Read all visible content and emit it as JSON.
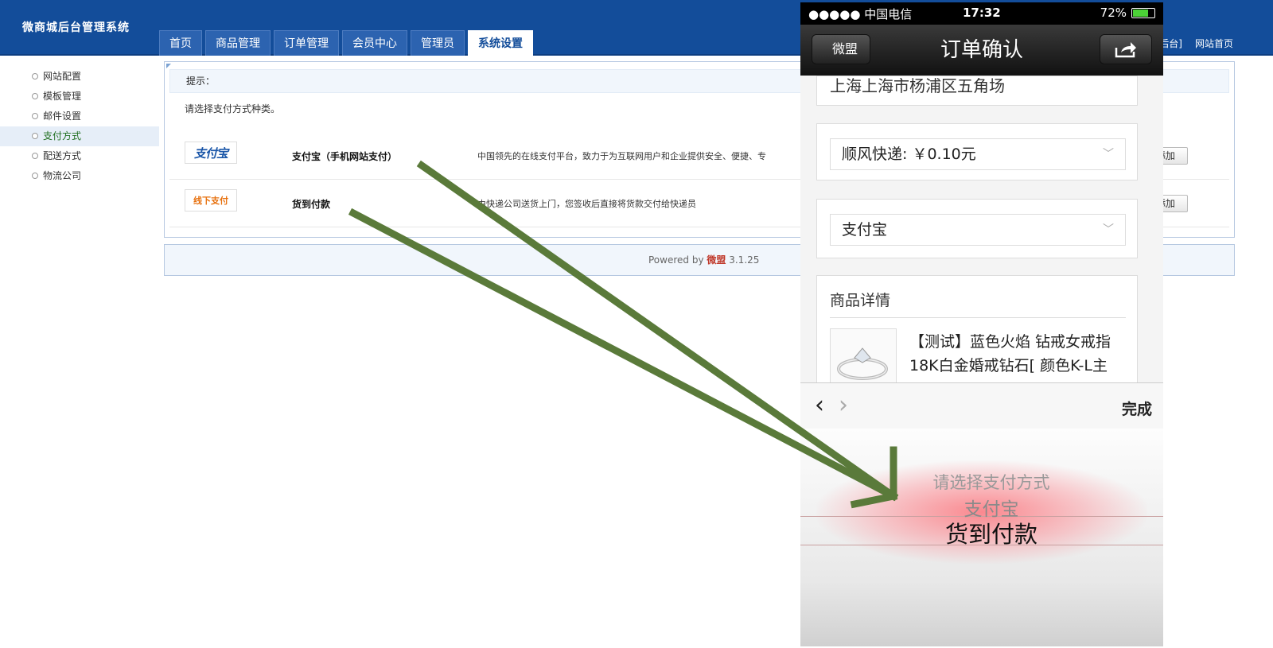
{
  "header": {
    "logo": "微商城后台管理系统",
    "tabs": [
      "首页",
      "商品管理",
      "订单管理",
      "会员中心",
      "管理员",
      "系统设置"
    ],
    "active_tab": "系统设置",
    "links": [
      "[微盟后台]",
      "网站首页"
    ]
  },
  "sidebar": {
    "items": [
      "网站配置",
      "模板管理",
      "邮件设置",
      "支付方式",
      "配送方式",
      "物流公司"
    ],
    "active": "支付方式"
  },
  "main": {
    "tip_label": "提示：",
    "hint": "请选择支付方式种类。",
    "payments": [
      {
        "logo": "支付宝",
        "name": "支付宝（手机网站支付）",
        "desc": "中国领先的在线支付平台，致力于为互联网用户和企业提供安全、便捷、专",
        "button": "添加"
      },
      {
        "logo": "线下支付",
        "name": "货到付款",
        "desc": "由快递公司送货上门，您签收后直接将货款交付给快递员",
        "button": "添加"
      }
    ]
  },
  "footer": {
    "powered": "Powered by",
    "brand": "微盟",
    "version": "3.1.25"
  },
  "phone": {
    "status": {
      "carrier": "●●●●● 中国电信",
      "time": "17:32",
      "battery": "72%",
      "battery_level": 0.72
    },
    "nav": {
      "back": "微盟",
      "title": "订单确认",
      "share_icon": "share-icon"
    },
    "address": "上海上海市杨浦区五角场",
    "shipping": "顺风快递: ￥0.10元",
    "payment": "支付宝",
    "goods": {
      "title": "商品详情",
      "name": "【测试】蓝色火焰 钻戒女戒指18K白金婚戒钻石[ 颜色K-L主"
    },
    "picker": {
      "done": "完成",
      "options": [
        "请选择支付方式",
        "支付宝",
        "货到付款"
      ],
      "selected": "货到付款"
    }
  },
  "colors": {
    "header_bg": "#134d9a",
    "arrow": "#5a7a3a",
    "active_sidebar_text": "#1f6e1f"
  }
}
